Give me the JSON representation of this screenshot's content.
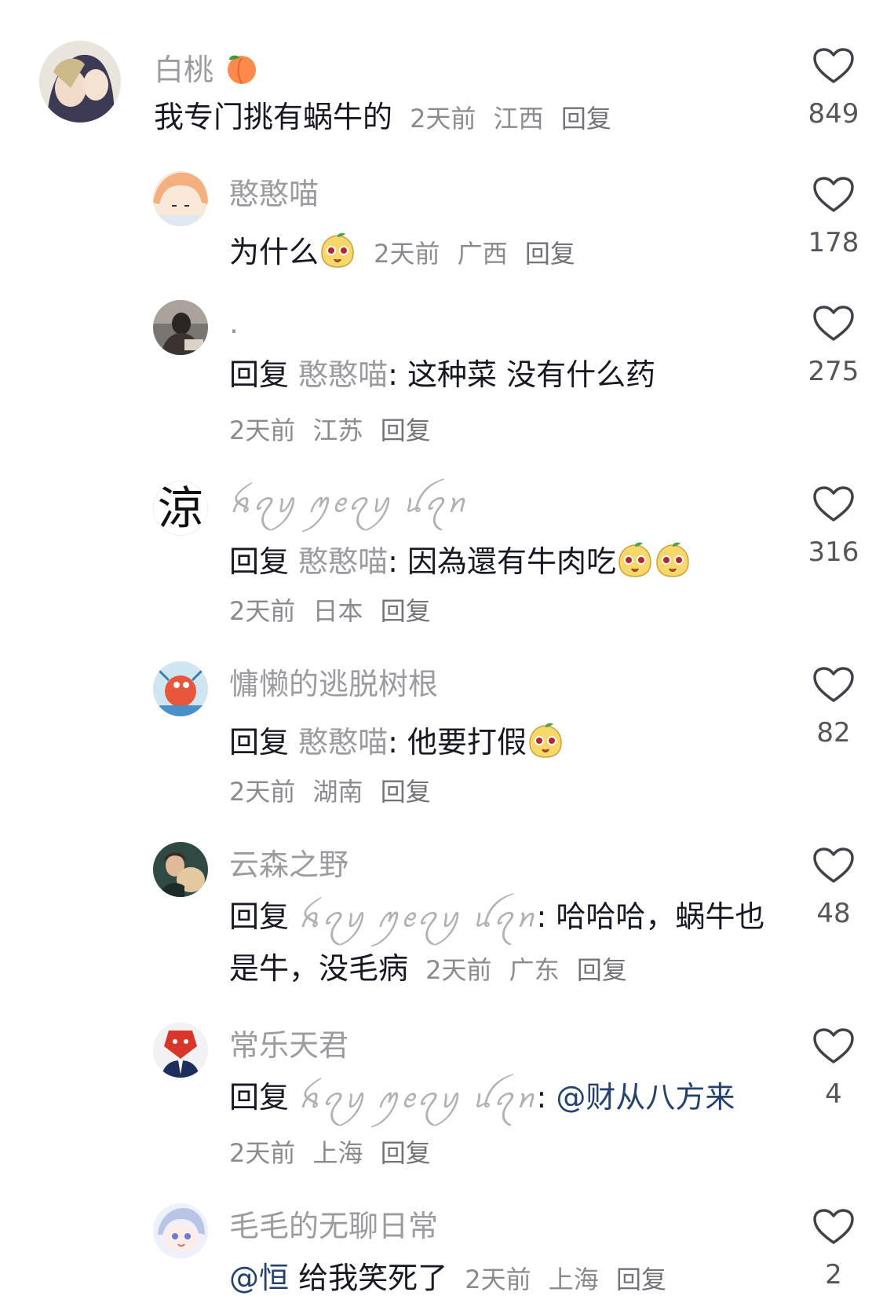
{
  "comments": [
    {
      "username": "白桃",
      "text": "我专门挑有蜗牛的",
      "time": "2天前",
      "location": "江西",
      "reply_label": "回复",
      "likes": "849"
    },
    {
      "username": "憨憨喵",
      "text": "为什么",
      "time": "2天前",
      "location": "广西",
      "reply_label": "回复",
      "likes": "178"
    },
    {
      "username": ".",
      "prefix": "回复",
      "target": "憨憨喵",
      "text": ": 这种菜  没有什么药",
      "time": "2天前",
      "location": "江苏",
      "reply_label": "回复",
      "likes": "275"
    },
    {
      "avatar_char": "涼",
      "username": "ꫝꪖꪗ ꪑꫀꪖꪗ ꪊꪖꪀ",
      "prefix": "回复",
      "target": "憨憨喵",
      "text": ": 因為還有牛肉吃",
      "time": "2天前",
      "location": "日本",
      "reply_label": "回复",
      "likes": "316"
    },
    {
      "username": "慵懒的逃脱树根",
      "prefix": "回复",
      "target": "憨憨喵",
      "text": ": 他要打假",
      "time": "2天前",
      "location": "湖南",
      "reply_label": "回复",
      "likes": "82"
    },
    {
      "username": "云森之野",
      "prefix": "回复",
      "target": "ꫝꪖꪗ ꪑꫀꪖꪗ ꪊꪖꪀ",
      "text": ": 哈哈哈，蜗牛也",
      "text2": "是牛，没毛病",
      "time": "2天前",
      "location": "广东",
      "reply_label": "回复",
      "likes": "48"
    },
    {
      "username": "常乐天君",
      "prefix": "回复",
      "target": "ꫝꪖꪗ ꪑꫀꪖꪗ ꪊꪖꪀ",
      "colon": ":",
      "mention": "@财从八方来",
      "time": "2天前",
      "location": "上海",
      "reply_label": "回复",
      "likes": "4"
    },
    {
      "username": "毛毛的无聊日常",
      "mention": "@恒",
      "text": " 给我笑死了",
      "time": "2天前",
      "location": "上海",
      "reply_label": "回复",
      "likes": "2"
    }
  ],
  "icons": {
    "like": "heart-outline-icon",
    "emoji": "mango-face-emoji",
    "peach": "peach-emoji"
  },
  "colors": {
    "username": "#9b9ba1",
    "mention": "#25426f",
    "meta": "#8a8b91"
  }
}
